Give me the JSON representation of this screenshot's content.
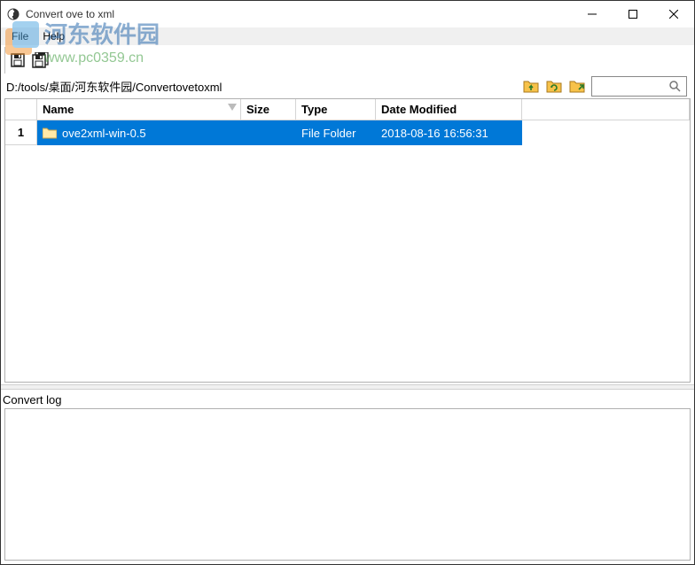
{
  "window": {
    "title": "Convert ove to xml"
  },
  "menu": {
    "file": "File",
    "help": "Help"
  },
  "path": "D:/tools/桌面/河东软件园/Convertovetoxml",
  "search": {
    "placeholder": ""
  },
  "columns": {
    "name": "Name",
    "size": "Size",
    "type": "Type",
    "date": "Date Modified"
  },
  "rows": [
    {
      "num": "1",
      "name": "ove2xml-win-0.5",
      "size": "",
      "type": "File Folder",
      "date": "2018-08-16 16:56:31",
      "selected": true
    }
  ],
  "log": {
    "label": "Convert log"
  },
  "watermark": {
    "line1": "河东软件园",
    "line2": "www.pc0359.cn"
  }
}
